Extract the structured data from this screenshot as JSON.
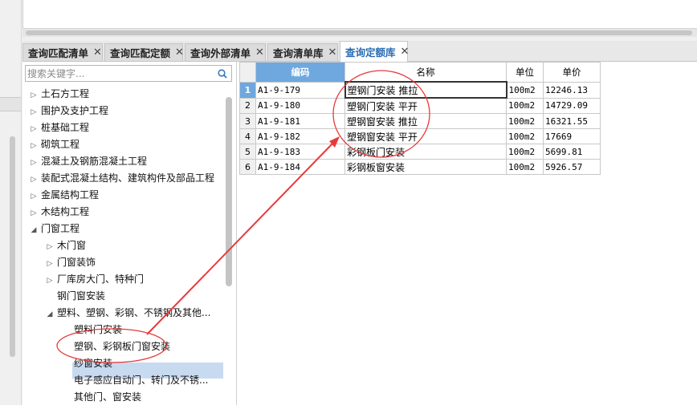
{
  "tabs": [
    {
      "label": "查询匹配清单",
      "active": false
    },
    {
      "label": "查询匹配定额",
      "active": false
    },
    {
      "label": "查询外部清单",
      "active": false
    },
    {
      "label": "查询清单库",
      "active": false
    },
    {
      "label": "查询定额库",
      "active": true
    }
  ],
  "tab_close_glyph": "✕",
  "search": {
    "placeholder": "搜索关键字..."
  },
  "tree": {
    "items": [
      {
        "label": "土石方工程",
        "expanded": false
      },
      {
        "label": "围护及支护工程",
        "expanded": false
      },
      {
        "label": "桩基础工程",
        "expanded": false
      },
      {
        "label": "砌筑工程",
        "expanded": false
      },
      {
        "label": "混凝土及钢筋混凝土工程",
        "expanded": false
      },
      {
        "label": "装配式混凝土结构、建筑构件及部品工程",
        "expanded": false
      },
      {
        "label": "金属结构工程",
        "expanded": false
      },
      {
        "label": "木结构工程",
        "expanded": false
      },
      {
        "label": "门窗工程",
        "expanded": true
      },
      {
        "label": "木门窗",
        "expanded": false
      },
      {
        "label": "门窗装饰",
        "expanded": false
      },
      {
        "label": "厂库房大门、特种门",
        "expanded": false
      },
      {
        "label": "钢门窗安装"
      },
      {
        "label": "塑料、塑钢、彩钢、不锈钢及其他...",
        "expanded": true
      },
      {
        "label": "塑料门安装"
      },
      {
        "label": "塑钢、彩钢板门窗安装",
        "selected": true
      },
      {
        "label": "纱窗安装"
      },
      {
        "label": "电子感应自动门、转门及不锈..."
      },
      {
        "label": "其他门、窗安装"
      }
    ]
  },
  "table": {
    "headers": {
      "code": "编码",
      "name": "名称",
      "unit": "单位",
      "price": "单价"
    },
    "rows": [
      {
        "num": "1",
        "code": "A1-9-179",
        "name": "塑钢门安装 推拉",
        "unit": "100m2",
        "price": "12246.13"
      },
      {
        "num": "2",
        "code": "A1-9-180",
        "name": "塑钢门安装 平开",
        "unit": "100m2",
        "price": "14729.09"
      },
      {
        "num": "3",
        "code": "A1-9-181",
        "name": "塑钢窗安装 推拉",
        "unit": "100m2",
        "price": "16321.55"
      },
      {
        "num": "4",
        "code": "A1-9-182",
        "name": "塑钢窗安装 平开",
        "unit": "100m2",
        "price": "17669"
      },
      {
        "num": "5",
        "code": "A1-9-183",
        "name": "彩钢板门安装",
        "unit": "100m2",
        "price": "5699.81"
      },
      {
        "num": "6",
        "code": "A1-9-184",
        "name": "彩钢板窗安装",
        "unit": "100m2",
        "price": "5926.57"
      }
    ]
  },
  "colors": {
    "accent": "#6ea8de",
    "annotation": "#e8393a",
    "active_tab_text": "#2a6db3"
  }
}
